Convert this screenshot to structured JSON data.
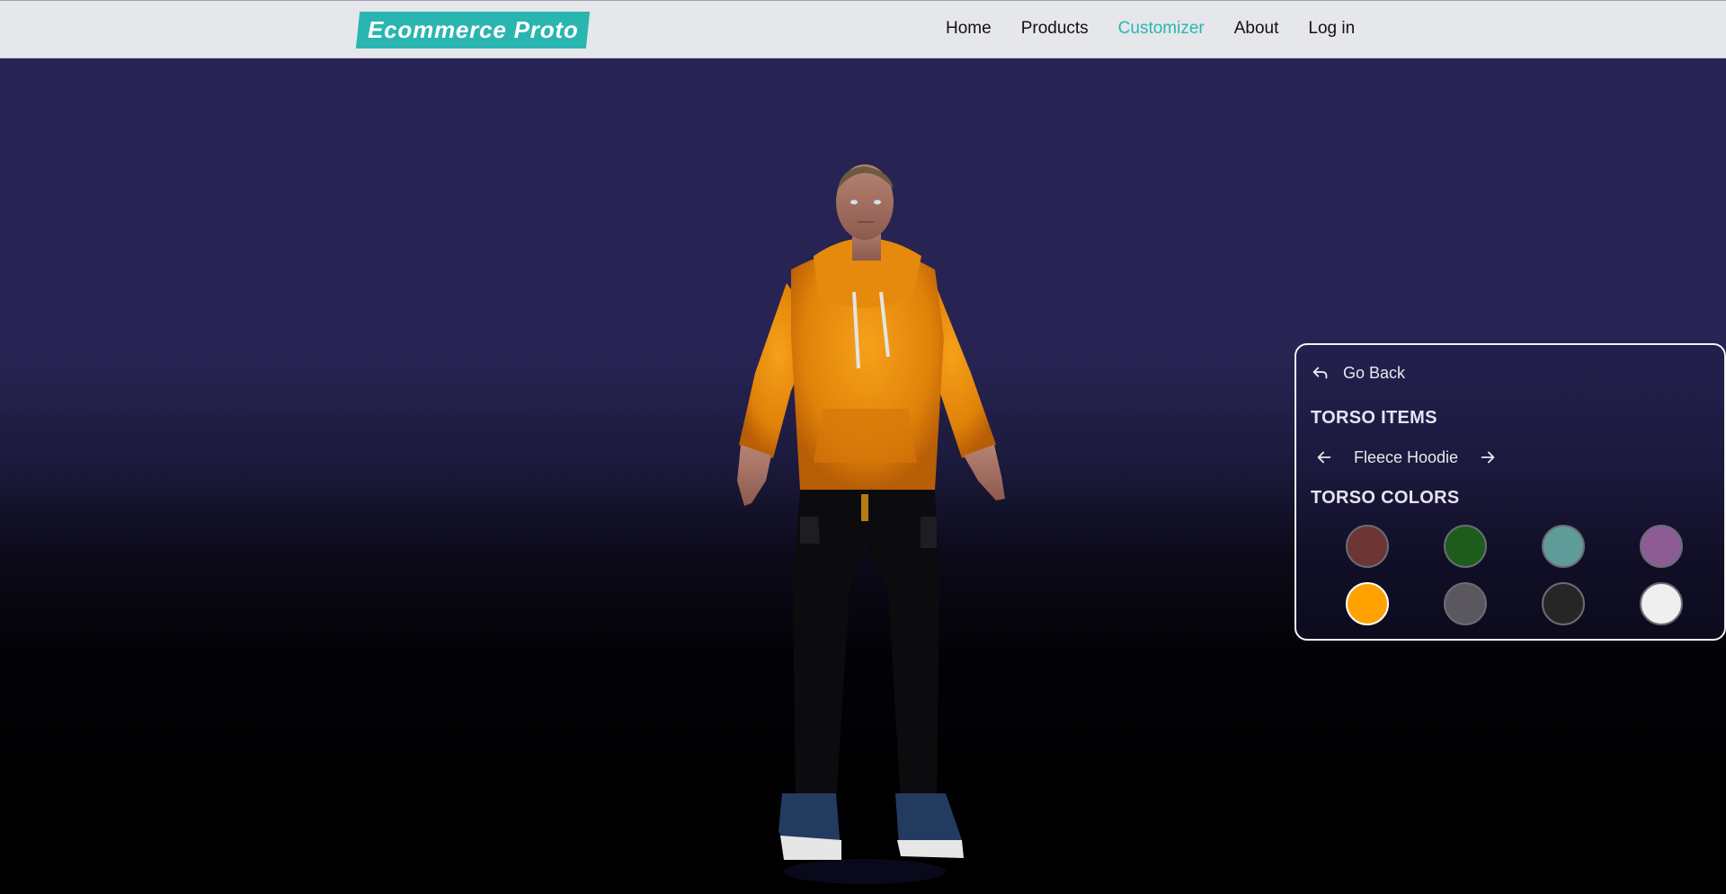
{
  "header": {
    "logo": "Ecommerce Proto",
    "nav": [
      {
        "label": "Home",
        "active": false
      },
      {
        "label": "Products",
        "active": false
      },
      {
        "label": "Customizer",
        "active": true
      },
      {
        "label": "About",
        "active": false
      },
      {
        "label": "Log in",
        "active": false
      }
    ],
    "accent_color": "#2bb5b0"
  },
  "panel": {
    "back_label": "Go Back",
    "items_title": "TORSO ITEMS",
    "current_item": "Fleece Hoodie",
    "colors_title": "TORSO COLORS",
    "colors": [
      {
        "hex": "#6e3535",
        "selected": false
      },
      {
        "hex": "#1e5c1c",
        "selected": false
      },
      {
        "hex": "#5f9c99",
        "selected": false
      },
      {
        "hex": "#8d5c95",
        "selected": false
      },
      {
        "hex": "#ffa200",
        "selected": true
      },
      {
        "hex": "#5a585e",
        "selected": false
      },
      {
        "hex": "#262626",
        "selected": false
      },
      {
        "hex": "#efefef",
        "selected": false
      }
    ]
  },
  "scene": {
    "model": "avatar-3d",
    "hoodie_color": "#f39a0a"
  }
}
